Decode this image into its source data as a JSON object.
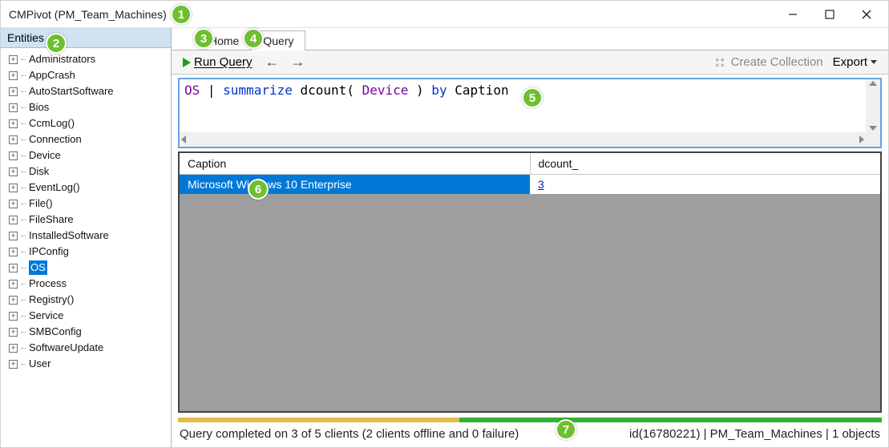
{
  "window": {
    "title": "CMPivot (PM_Team_Machines)"
  },
  "sidebar": {
    "header": "Entities",
    "items": [
      {
        "label": "Administrators"
      },
      {
        "label": "AppCrash"
      },
      {
        "label": "AutoStartSoftware"
      },
      {
        "label": "Bios"
      },
      {
        "label": "CcmLog()"
      },
      {
        "label": "Connection"
      },
      {
        "label": "Device"
      },
      {
        "label": "Disk"
      },
      {
        "label": "EventLog()"
      },
      {
        "label": "File()"
      },
      {
        "label": "FileShare"
      },
      {
        "label": "InstalledSoftware"
      },
      {
        "label": "IPConfig"
      },
      {
        "label": "OS",
        "selected": true
      },
      {
        "label": "Process"
      },
      {
        "label": "Registry()"
      },
      {
        "label": "Service"
      },
      {
        "label": "SMBConfig"
      },
      {
        "label": "SoftwareUpdate"
      },
      {
        "label": "User"
      }
    ]
  },
  "tabs": {
    "home": "Home",
    "query": "Query"
  },
  "toolbar": {
    "run": "Run Query",
    "create_collection": "Create Collection",
    "export": "Export"
  },
  "query": {
    "tokens": {
      "ent": "OS",
      "pipe": " | ",
      "summ": "summarize",
      "sp1": " ",
      "dcount": "dcount(",
      "sp2": " ",
      "device": "Device",
      "sp3": " ",
      "close": ")",
      "by": " by ",
      "caption": "Caption"
    }
  },
  "results": {
    "col1": "Caption",
    "col2": "dcount_",
    "row1_caption": "Microsoft Windows 10 Enterprise",
    "row1_dcount": "3"
  },
  "status": {
    "left": "Query completed on 3 of 5 clients (2 clients offline and 0 failure)",
    "right": "id(16780221)  |  PM_Team_Machines  |  1 objects"
  },
  "annotations": {
    "a1": "1",
    "a2": "2",
    "a3": "3",
    "a4": "4",
    "a5": "5",
    "a6": "6",
    "a7": "7"
  }
}
